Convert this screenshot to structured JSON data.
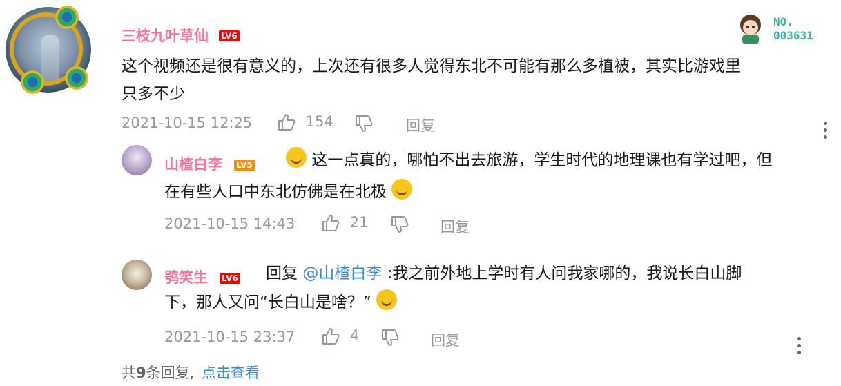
{
  "top_comment": {
    "username": "三枝九叶草仙",
    "level": "LV6",
    "text": "这个视频还是很有意义的，上次还有很多人觉得东北不可能有那么多植被，其实比游戏里只多不少",
    "text_line1": "这个视频还是很有意义的，上次还有很多人觉得东北不可能有那么多植被，其实比游戏里",
    "text_line2": "只多不少",
    "time": "2021-10-15 12:25",
    "likes": "154",
    "reply_label": "回复",
    "badge_no": "NO.",
    "badge_number": "003631"
  },
  "replies": [
    {
      "username": "山楂白李",
      "level": "LV5",
      "text_line1": "这一点真的，哪怕不出去旅游，学生时代的地理课也有学过吧，但",
      "text_line2": "在有些人口中东北仿佛是在北极",
      "time": "2021-10-15 14:43",
      "likes": "21",
      "reply_label": "回复"
    },
    {
      "username": "鸮笑生",
      "level": "LV6",
      "reply_prefix": "回复",
      "mention": "@山楂白李",
      "text_line1": ":我之前外地上学时有人问我家哪的，我说长白山脚",
      "text_line2": "下，那人又问“长白山是啥？”",
      "time": "2021-10-15 23:37",
      "likes": "4",
      "reply_label": "回复"
    }
  ],
  "footer": {
    "prefix": "共",
    "count": "9",
    "suffix": "条回复,",
    "link": "点击查看"
  },
  "icons": {
    "like": "thumb-up-icon",
    "dislike": "thumb-down-icon",
    "more": "more-vertical-icon"
  }
}
